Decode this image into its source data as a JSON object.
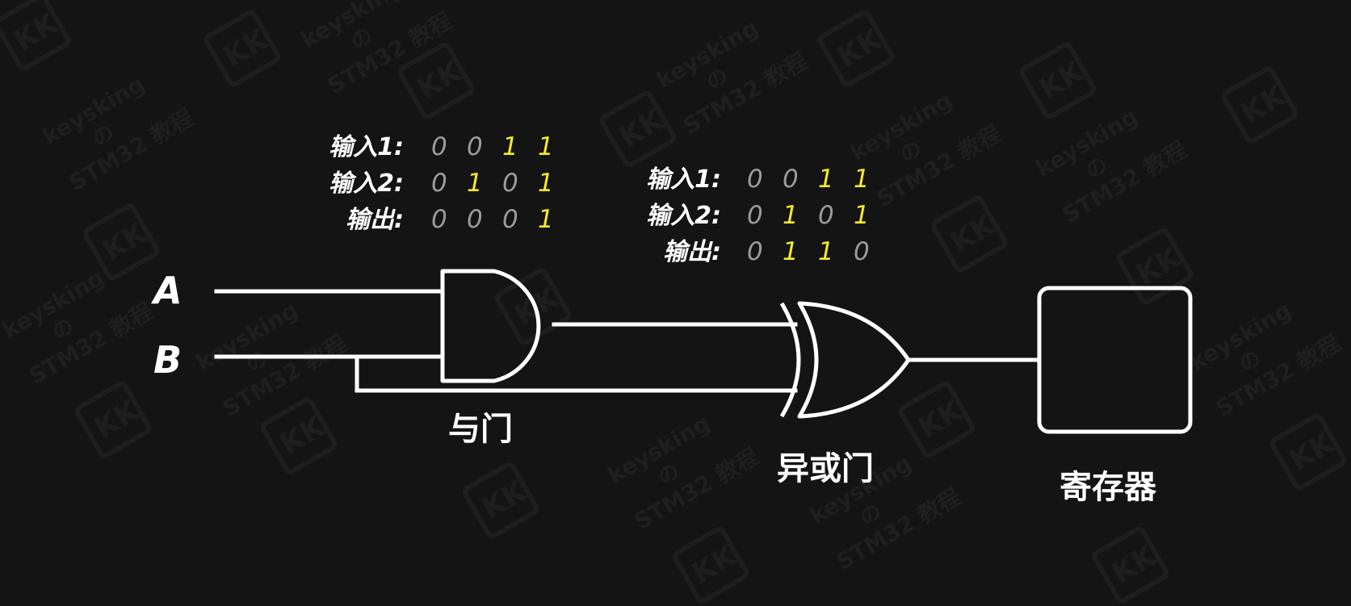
{
  "colors": {
    "background": "#141414",
    "line": "#ffffff",
    "zero": "#9a9a9a",
    "one": "#f5e92a",
    "watermark": "#1f1f1f"
  },
  "watermark": {
    "logo": "KK",
    "line1": "keysking",
    "line2": "の",
    "line3": "STM32 教程"
  },
  "inputs": {
    "a": "A",
    "b": "B"
  },
  "and_gate": {
    "caption": "与门",
    "truth_table": [
      {
        "label": "输入1:",
        "values": [
          "0",
          "0",
          "1",
          "1"
        ]
      },
      {
        "label": "输入2:",
        "values": [
          "0",
          "1",
          "0",
          "1"
        ]
      },
      {
        "label": "输出:",
        "values": [
          "0",
          "0",
          "0",
          "1"
        ]
      }
    ]
  },
  "xor_gate": {
    "caption": "异或门",
    "truth_table": [
      {
        "label": "输入1:",
        "values": [
          "0",
          "0",
          "1",
          "1"
        ]
      },
      {
        "label": "输入2:",
        "values": [
          "0",
          "1",
          "0",
          "1"
        ]
      },
      {
        "label": "输出:",
        "values": [
          "0",
          "1",
          "1",
          "0"
        ]
      }
    ]
  },
  "register": {
    "caption": "寄存器"
  }
}
